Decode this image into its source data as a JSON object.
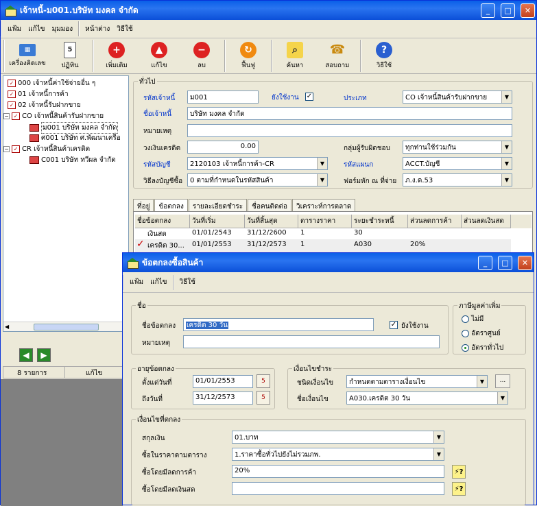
{
  "main": {
    "title": "เจ้าหนี้-ม001.บริษัท  มงคล  จำกัด",
    "menu": [
      "แฟ้ม",
      "แก้ไข",
      "มุมมอง",
      "หน้าต่าง",
      "วิธีใช้"
    ],
    "toolbar": [
      "เครื่องคิดเลข",
      "ปฏิทิน",
      "เพิ่มเติม",
      "แก้ไข",
      "ลบ",
      "ฟื้นฟู",
      "ค้นหา",
      "สอบถาม",
      "วิธีใช้"
    ],
    "tree": [
      "000 เจ้าหนี้ค่าใช้จ่ายอื่น ๆ",
      "01 เจ้าหนี้การค้า",
      "02 เจ้าหนี้รับฝากขาย",
      "CO เจ้าหนี้สินค้ารับฝากขาย",
      "ม001 บริษัท มงคล จำกัด",
      "ศ001 บริษัท ศ.พัฒนาเครื่อ",
      "CR เจ้าหนี้สินค้าเครดิต",
      "C001 บริษัท ทวีผล จำกัด"
    ],
    "status_count": "8 รายการ",
    "status_mode": "แก้ไข",
    "general_title": "ทั่วไป",
    "code_label": "รหัสเจ้าหนี้",
    "code_value": "ม001",
    "active_label": "ยังใช้งาน",
    "type_label": "ประเภท",
    "type_value": "CO เจ้าหนี้สินค้ารับฝากขาย",
    "name_label": "ชื่อเจ้าหนี้",
    "name_value": "บริษัท มงคล จำกัด",
    "note_label": "หมายเหตุ",
    "credit_label": "วงเงินเครดิต",
    "credit_value": "0.00",
    "resp_group_label": "กลุ่มผู้รับผิดชอบ",
    "resp_group_value": "ทุกท่านใช้ร่วมกัน",
    "account_label": "รหัสบัญชี",
    "account_value": "2120103 เจ้าหนี้การค้า-CR",
    "dept_label": "รหัสแผนก",
    "dept_value": "ACCT.บัญชี",
    "acctmethod_label": "วิธีลงบัญชีซื้อ",
    "acctmethod_value": "0 ตามที่กำหนดในรหัสสินค้า",
    "wht_label": "ฟอร์มหัก ณ ที่จ่าย",
    "wht_value": "ภ.ง.ด.53",
    "tabs": [
      "ที่อยู่",
      "ข้อตกลง",
      "รายละเอียดชำระ",
      "ชื่อคนติดต่อ",
      "วิเคราะห์การตลาด"
    ],
    "grid_headers": [
      "ชื่อข้อตกลง",
      "วันที่เริ่ม",
      "วันที่สิ้นสุด",
      "ตารางราคา",
      "ระยะชำระหนี้",
      "ส่วนลดการค้า",
      "ส่วนลดเงินสด"
    ],
    "grid_rows": [
      [
        "เงินสด",
        "01/01/2543",
        "31/12/2600",
        "1",
        "30",
        "",
        ""
      ],
      [
        "เครดิต 30...",
        "01/01/2553",
        "31/12/2573",
        "1",
        "A030",
        "20%",
        ""
      ]
    ]
  },
  "dialog": {
    "title": "ข้อตกลงซื้อสินค้า",
    "menu": [
      "แฟ้ม",
      "แก้ไข",
      "วิธีใช้"
    ],
    "name_group": "ชื่อ",
    "agreement_label": "ชื่อข้อตกลง",
    "agreement_value": "เครดิต 30 วัน",
    "active_label": "ยังใช้งาน",
    "note_label": "หมายเหตุ",
    "vat_group": "ภาษีมูลค่าเพิ่ม",
    "vat_options": [
      "ไม่มี",
      "อัตราศูนย์",
      "อัตราทั่วไป"
    ],
    "age_group": "อายุข้อตกลง",
    "from_label": "ตั้งแต่วันที่",
    "from_value": "01/01/2553",
    "to_label": "ถึงวันที่",
    "to_value": "31/12/2573",
    "cond_group": "เงื่อนไขชำระ",
    "cond_type_label": "ชนิดเงื่อนไข",
    "cond_type_value": "กำหนดตามตารางเงื่อนไข",
    "cond_name_label": "ชื่อเงื่อนไข",
    "cond_name_value": "A030.เครดิต 30 วัน",
    "terms_group": "เงื่อนไขที่ตกลง",
    "currency_label": "สกุลเงิน",
    "currency_value": "01.บาท",
    "price_label": "ซื้อในราคาตามตาราง",
    "price_value": "1.ราคาซื้อทั่วไปยังไม่รวมภพ.",
    "trade_disc_label": "ซื้อโดยมีลดการค้า",
    "trade_disc_value": "20%",
    "cash_disc_label": "ซื้อโดยมีลดเงินสด",
    "cash_disc_value": ""
  }
}
